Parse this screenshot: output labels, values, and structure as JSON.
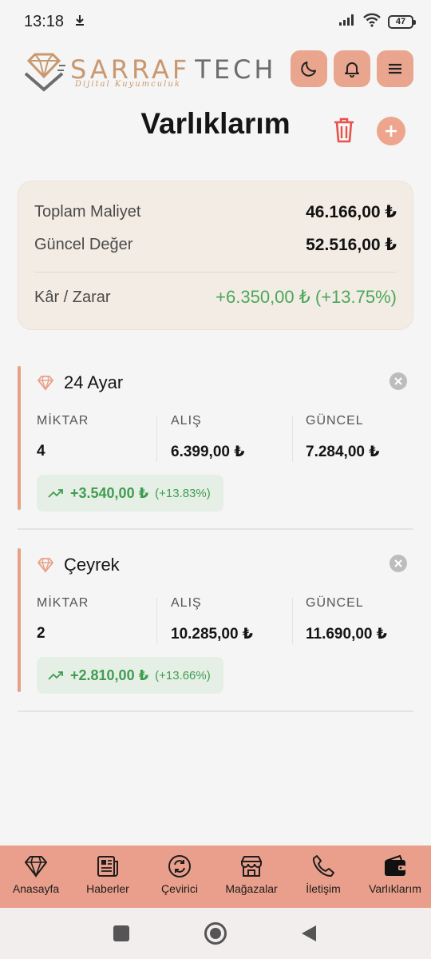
{
  "status_bar": {
    "time": "13:18",
    "battery": "47"
  },
  "brand": {
    "name_part1": "SARRAF",
    "name_part2": "TECH",
    "tagline": "Dijital Kuyumculuk"
  },
  "page": {
    "title": "Varlıklarım"
  },
  "summary": {
    "total_cost_label": "Toplam Maliyet",
    "total_cost_value": "46.166,00 ₺",
    "current_value_label": "Güncel Değer",
    "current_value_value": "52.516,00 ₺",
    "profit_label": "Kâr / Zarar",
    "profit_value": "+6.350,00 ₺ (+13.75%)"
  },
  "columns": {
    "quantity": "MİKTAR",
    "buy": "ALIŞ",
    "current": "GÜNCEL"
  },
  "assets": [
    {
      "name": "24 Ayar",
      "quantity": "4",
      "buy": "6.399,00 ₺",
      "current": "7.284,00 ₺",
      "gain": "+3.540,00 ₺",
      "gain_pct": "(+13.83%)"
    },
    {
      "name": "Çeyrek",
      "quantity": "2",
      "buy": "10.285,00 ₺",
      "current": "11.690,00 ₺",
      "gain": "+2.810,00 ₺",
      "gain_pct": "(+13.66%)"
    }
  ],
  "nav": [
    {
      "label": "Anasayfa",
      "icon": "diamond-icon"
    },
    {
      "label": "Haberler",
      "icon": "newspaper-icon"
    },
    {
      "label": "Çevirici",
      "icon": "converter-icon"
    },
    {
      "label": "Mağazalar",
      "icon": "store-icon"
    },
    {
      "label": "İletişim",
      "icon": "phone-icon"
    },
    {
      "label": "Varlıklarım",
      "icon": "wallet-icon"
    }
  ],
  "colors": {
    "accent": "#e99f8b",
    "profit": "#4aa85a",
    "delete": "#e8524a",
    "summary_bg": "#f3ece4"
  }
}
